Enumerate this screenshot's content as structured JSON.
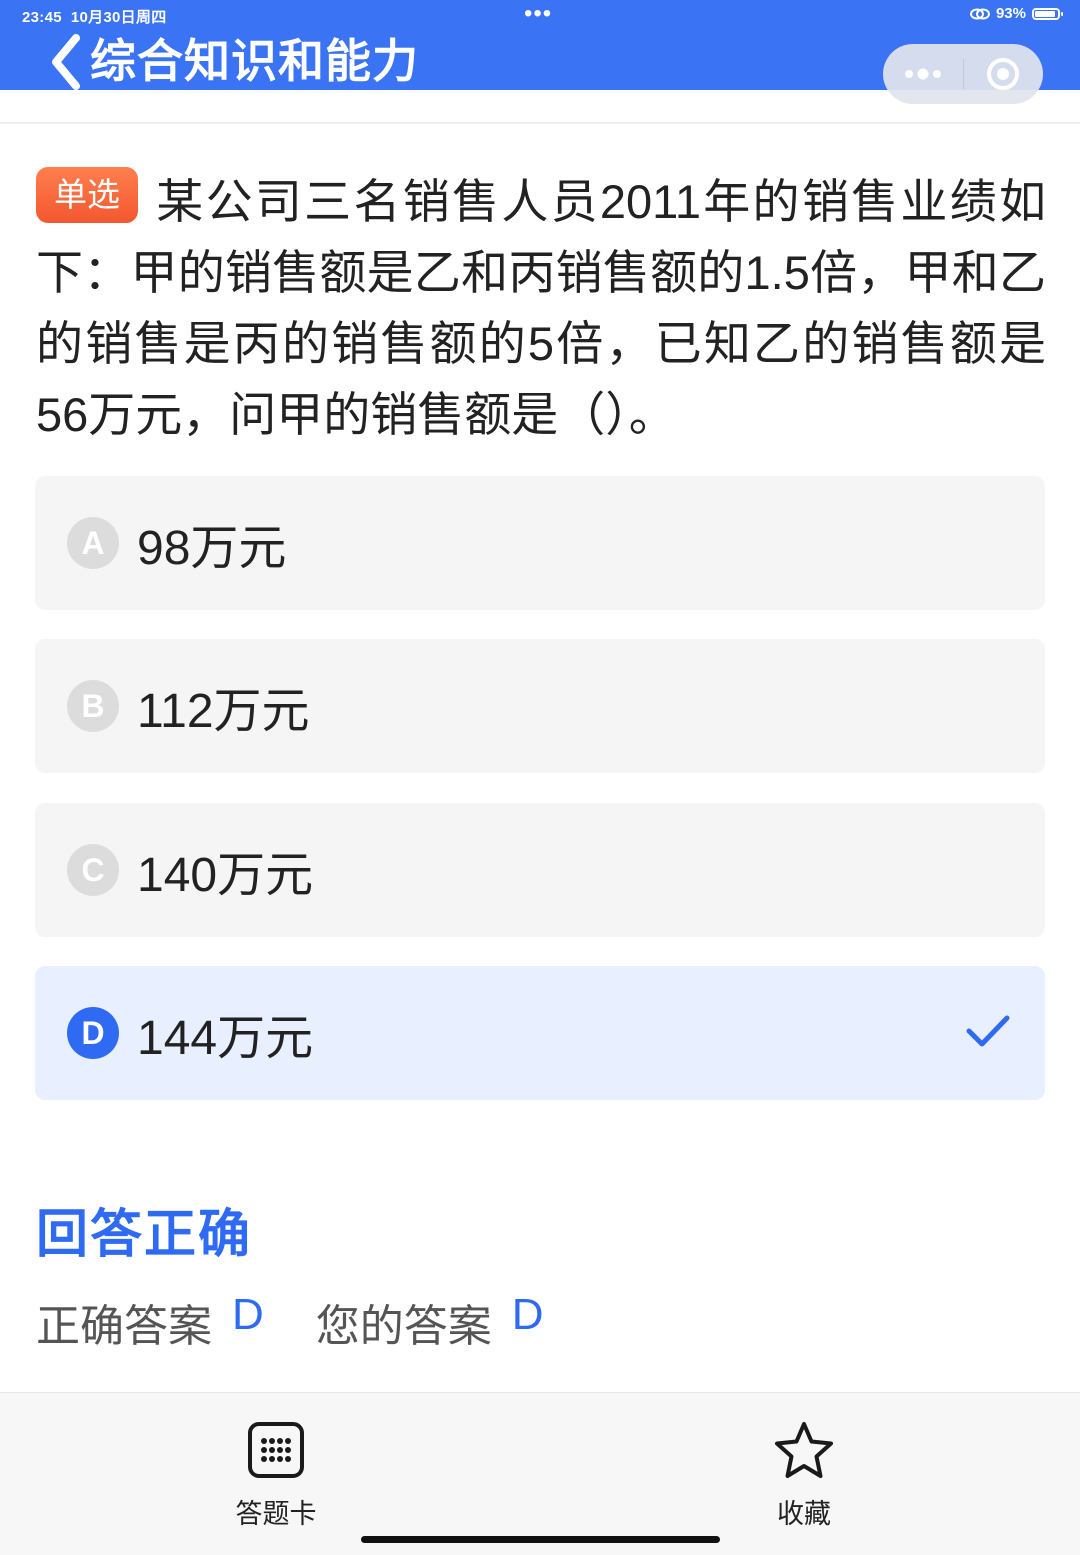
{
  "status_bar": {
    "time": "23:45",
    "date": "10月30日周四",
    "dots": "•••",
    "battery_percent": "93%",
    "battery_level": 0.93
  },
  "header": {
    "title": "综合知识和能力",
    "capsule_more_icon": "more-dots-icon",
    "capsule_close_icon": "target-circle-icon"
  },
  "question": {
    "type_tag": "单选",
    "text": "某公司三名销售人员2011年的销售业绩如下：甲的销售额是乙和丙销售额的1.5倍，甲和乙的销售是丙的销售额的5倍，已知乙的销售额是56万元，问甲的销售额是（）。"
  },
  "options": [
    {
      "letter": "A",
      "text": "98万元",
      "selected": false
    },
    {
      "letter": "B",
      "text": "112万元",
      "selected": false
    },
    {
      "letter": "C",
      "text": "140万元",
      "selected": false
    },
    {
      "letter": "D",
      "text": "144万元",
      "selected": true
    }
  ],
  "result": {
    "title": "回答正确",
    "correct_label": "正确答案",
    "correct_value": "D",
    "your_label": "您的答案",
    "your_value": "D"
  },
  "bottom_bar": {
    "answer_card_label": "答题卡",
    "answer_card_icon": "grid-icon",
    "favorite_label": "收藏",
    "favorite_icon": "star-icon"
  },
  "colors": {
    "header_blue": "#3a73f4",
    "accent_blue": "#2f6bf2",
    "tag_orange": "#f35730",
    "selected_bg": "#e8efff",
    "option_bg": "#f5f5f5"
  }
}
